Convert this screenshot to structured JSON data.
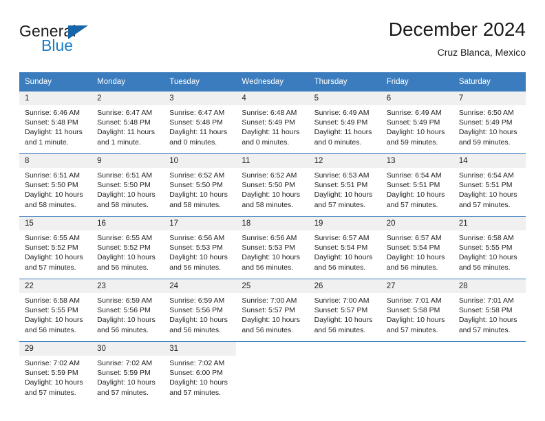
{
  "brand": {
    "name_part1": "General",
    "name_part2": "Blue",
    "flag_icon": "triangle-flag-icon",
    "accent_color": "#1a7bc4"
  },
  "header": {
    "title": "December 2024",
    "subtitle": "Cruz Blanca, Mexico"
  },
  "theme": {
    "header_blue": "#3a7cbe",
    "daynum_bg": "#f0f0f0",
    "text": "#222222"
  },
  "calendar": {
    "weekday_headers": [
      "Sunday",
      "Monday",
      "Tuesday",
      "Wednesday",
      "Thursday",
      "Friday",
      "Saturday"
    ],
    "weeks": [
      [
        {
          "day": "1",
          "sunrise": "Sunrise: 6:46 AM",
          "sunset": "Sunset: 5:48 PM",
          "daylight": "Daylight: 11 hours and 1 minute."
        },
        {
          "day": "2",
          "sunrise": "Sunrise: 6:47 AM",
          "sunset": "Sunset: 5:48 PM",
          "daylight": "Daylight: 11 hours and 1 minute."
        },
        {
          "day": "3",
          "sunrise": "Sunrise: 6:47 AM",
          "sunset": "Sunset: 5:48 PM",
          "daylight": "Daylight: 11 hours and 0 minutes."
        },
        {
          "day": "4",
          "sunrise": "Sunrise: 6:48 AM",
          "sunset": "Sunset: 5:49 PM",
          "daylight": "Daylight: 11 hours and 0 minutes."
        },
        {
          "day": "5",
          "sunrise": "Sunrise: 6:49 AM",
          "sunset": "Sunset: 5:49 PM",
          "daylight": "Daylight: 11 hours and 0 minutes."
        },
        {
          "day": "6",
          "sunrise": "Sunrise: 6:49 AM",
          "sunset": "Sunset: 5:49 PM",
          "daylight": "Daylight: 10 hours and 59 minutes."
        },
        {
          "day": "7",
          "sunrise": "Sunrise: 6:50 AM",
          "sunset": "Sunset: 5:49 PM",
          "daylight": "Daylight: 10 hours and 59 minutes."
        }
      ],
      [
        {
          "day": "8",
          "sunrise": "Sunrise: 6:51 AM",
          "sunset": "Sunset: 5:50 PM",
          "daylight": "Daylight: 10 hours and 58 minutes."
        },
        {
          "day": "9",
          "sunrise": "Sunrise: 6:51 AM",
          "sunset": "Sunset: 5:50 PM",
          "daylight": "Daylight: 10 hours and 58 minutes."
        },
        {
          "day": "10",
          "sunrise": "Sunrise: 6:52 AM",
          "sunset": "Sunset: 5:50 PM",
          "daylight": "Daylight: 10 hours and 58 minutes."
        },
        {
          "day": "11",
          "sunrise": "Sunrise: 6:52 AM",
          "sunset": "Sunset: 5:50 PM",
          "daylight": "Daylight: 10 hours and 58 minutes."
        },
        {
          "day": "12",
          "sunrise": "Sunrise: 6:53 AM",
          "sunset": "Sunset: 5:51 PM",
          "daylight": "Daylight: 10 hours and 57 minutes."
        },
        {
          "day": "13",
          "sunrise": "Sunrise: 6:54 AM",
          "sunset": "Sunset: 5:51 PM",
          "daylight": "Daylight: 10 hours and 57 minutes."
        },
        {
          "day": "14",
          "sunrise": "Sunrise: 6:54 AM",
          "sunset": "Sunset: 5:51 PM",
          "daylight": "Daylight: 10 hours and 57 minutes."
        }
      ],
      [
        {
          "day": "15",
          "sunrise": "Sunrise: 6:55 AM",
          "sunset": "Sunset: 5:52 PM",
          "daylight": "Daylight: 10 hours and 57 minutes."
        },
        {
          "day": "16",
          "sunrise": "Sunrise: 6:55 AM",
          "sunset": "Sunset: 5:52 PM",
          "daylight": "Daylight: 10 hours and 56 minutes."
        },
        {
          "day": "17",
          "sunrise": "Sunrise: 6:56 AM",
          "sunset": "Sunset: 5:53 PM",
          "daylight": "Daylight: 10 hours and 56 minutes."
        },
        {
          "day": "18",
          "sunrise": "Sunrise: 6:56 AM",
          "sunset": "Sunset: 5:53 PM",
          "daylight": "Daylight: 10 hours and 56 minutes."
        },
        {
          "day": "19",
          "sunrise": "Sunrise: 6:57 AM",
          "sunset": "Sunset: 5:54 PM",
          "daylight": "Daylight: 10 hours and 56 minutes."
        },
        {
          "day": "20",
          "sunrise": "Sunrise: 6:57 AM",
          "sunset": "Sunset: 5:54 PM",
          "daylight": "Daylight: 10 hours and 56 minutes."
        },
        {
          "day": "21",
          "sunrise": "Sunrise: 6:58 AM",
          "sunset": "Sunset: 5:55 PM",
          "daylight": "Daylight: 10 hours and 56 minutes."
        }
      ],
      [
        {
          "day": "22",
          "sunrise": "Sunrise: 6:58 AM",
          "sunset": "Sunset: 5:55 PM",
          "daylight": "Daylight: 10 hours and 56 minutes."
        },
        {
          "day": "23",
          "sunrise": "Sunrise: 6:59 AM",
          "sunset": "Sunset: 5:56 PM",
          "daylight": "Daylight: 10 hours and 56 minutes."
        },
        {
          "day": "24",
          "sunrise": "Sunrise: 6:59 AM",
          "sunset": "Sunset: 5:56 PM",
          "daylight": "Daylight: 10 hours and 56 minutes."
        },
        {
          "day": "25",
          "sunrise": "Sunrise: 7:00 AM",
          "sunset": "Sunset: 5:57 PM",
          "daylight": "Daylight: 10 hours and 56 minutes."
        },
        {
          "day": "26",
          "sunrise": "Sunrise: 7:00 AM",
          "sunset": "Sunset: 5:57 PM",
          "daylight": "Daylight: 10 hours and 56 minutes."
        },
        {
          "day": "27",
          "sunrise": "Sunrise: 7:01 AM",
          "sunset": "Sunset: 5:58 PM",
          "daylight": "Daylight: 10 hours and 57 minutes."
        },
        {
          "day": "28",
          "sunrise": "Sunrise: 7:01 AM",
          "sunset": "Sunset: 5:58 PM",
          "daylight": "Daylight: 10 hours and 57 minutes."
        }
      ],
      [
        {
          "day": "29",
          "sunrise": "Sunrise: 7:02 AM",
          "sunset": "Sunset: 5:59 PM",
          "daylight": "Daylight: 10 hours and 57 minutes."
        },
        {
          "day": "30",
          "sunrise": "Sunrise: 7:02 AM",
          "sunset": "Sunset: 5:59 PM",
          "daylight": "Daylight: 10 hours and 57 minutes."
        },
        {
          "day": "31",
          "sunrise": "Sunrise: 7:02 AM",
          "sunset": "Sunset: 6:00 PM",
          "daylight": "Daylight: 10 hours and 57 minutes."
        },
        {
          "day": "",
          "sunrise": "",
          "sunset": "",
          "daylight": ""
        },
        {
          "day": "",
          "sunrise": "",
          "sunset": "",
          "daylight": ""
        },
        {
          "day": "",
          "sunrise": "",
          "sunset": "",
          "daylight": ""
        },
        {
          "day": "",
          "sunrise": "",
          "sunset": "",
          "daylight": ""
        }
      ]
    ]
  }
}
